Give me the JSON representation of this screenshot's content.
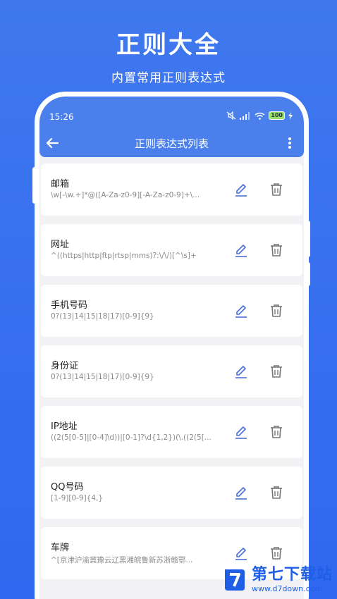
{
  "promo": {
    "title": "正则大全",
    "subtitle": "内置常用正则表达式"
  },
  "statusbar": {
    "time": "15:26",
    "battery": "100"
  },
  "appbar": {
    "title": "正则表达式列表"
  },
  "items": [
    {
      "name": "邮箱",
      "pattern": "\\w[-\\w.+]*@([A-Za-z0-9][-A-Za-z0-9]+\\..."
    },
    {
      "name": "网址",
      "pattern": "^((https|http|ftp|rtsp|mms)?:\\/\\/)[^\\s]+"
    },
    {
      "name": "手机号码",
      "pattern": "0?(13|14|15|18|17)[0-9]{9}"
    },
    {
      "name": "身份证",
      "pattern": "0?(13|14|15|18|17)[0-9]{9}"
    },
    {
      "name": "IP地址",
      "pattern": "((2(5[0-5]|[0-4]\\d))|[0-1]?\\d{1,2})(\\.((2(5[..."
    },
    {
      "name": "QQ号码",
      "pattern": "[1-9][0-9]{4,}"
    },
    {
      "name": "车牌",
      "pattern": "^[京津沪渝冀豫云辽黑湘皖鲁新苏浙赣鄂..."
    }
  ],
  "watermark": {
    "main": "第七下载站",
    "url": "www.d7down.com"
  },
  "colors": {
    "background": "#3f78ee",
    "appbar": "#4a7fec",
    "icon": "#4a6fd8"
  }
}
